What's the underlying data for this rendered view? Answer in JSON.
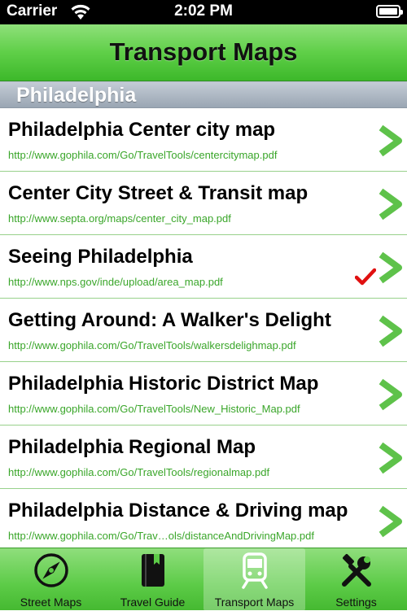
{
  "status_bar": {
    "carrier": "Carrier",
    "time": "2:02 PM"
  },
  "nav": {
    "title": "Transport Maps"
  },
  "section": {
    "title": "Philadelphia"
  },
  "rows": [
    {
      "title": "Philadelphia Center city map",
      "url": "http://www.gophila.com/Go/TravelTools/centercitymap.pdf",
      "checked": false
    },
    {
      "title": "Center City Street & Transit map",
      "url": "http://www.septa.org/maps/center_city_map.pdf",
      "checked": false
    },
    {
      "title": "Seeing Philadelphia",
      "url": "http://www.nps.gov/inde/upload/area_map.pdf",
      "checked": true
    },
    {
      "title": "Getting Around: A Walker's Delight",
      "url": "http://www.gophila.com/Go/TravelTools/walkersdelighmap.pdf",
      "checked": false
    },
    {
      "title": "Philadelphia Historic District Map",
      "url": "http://www.gophila.com/Go/TravelTools/New_Historic_Map.pdf",
      "checked": false
    },
    {
      "title": "Philadelphia Regional Map",
      "url": "http://www.gophila.com/Go/TravelTools/regionalmap.pdf",
      "checked": false
    },
    {
      "title": "Philadelphia Distance & Driving map",
      "url": "http://www.gophila.com/Go/Trav…ols/distanceAndDrivingMap.pdf",
      "checked": false
    }
  ],
  "tabs": [
    {
      "label": "Street Maps",
      "icon": "compass-icon",
      "active": false
    },
    {
      "label": "Travel Guide",
      "icon": "book-icon",
      "active": false
    },
    {
      "label": "Transport Maps",
      "icon": "train-icon",
      "active": true
    },
    {
      "label": "Settings",
      "icon": "tools-icon",
      "active": false
    }
  ],
  "colors": {
    "accent_green": "#5fcf48",
    "url_green": "#3aa62a",
    "check_red": "#e01010",
    "chevron_green": "#5ec24a"
  }
}
